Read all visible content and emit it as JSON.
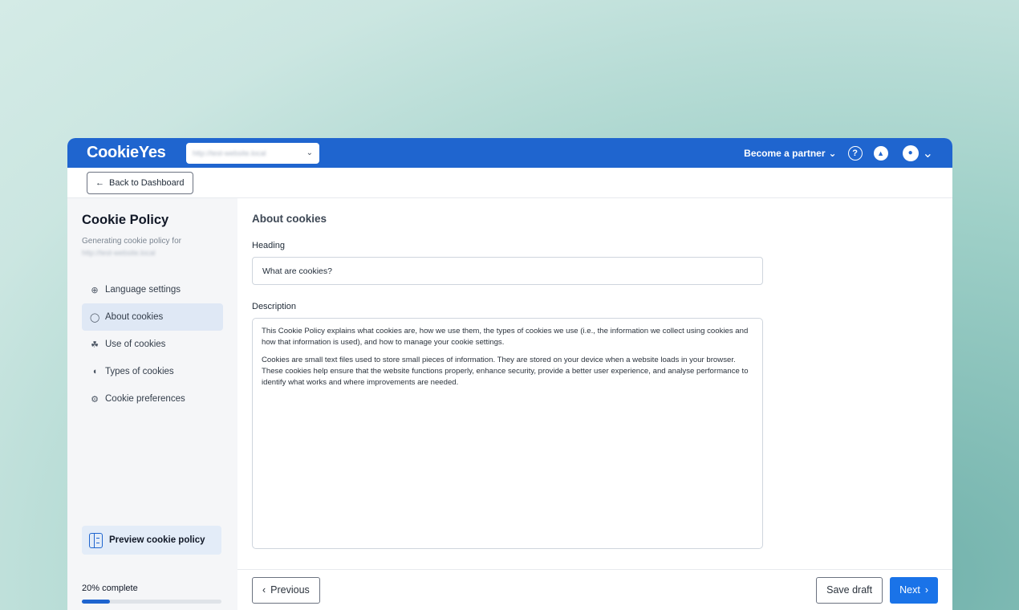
{
  "topbar": {
    "logo": "CookieYes",
    "site_url": "http://test-website.local",
    "partner_label": "Become a partner",
    "icons": [
      "help-icon",
      "bell-icon",
      "user-icon"
    ]
  },
  "subbar": {
    "back_label": "Back to Dashboard"
  },
  "sidebar": {
    "title": "Cookie Policy",
    "subtitle": "Generating cookie policy for",
    "site_url": "http://test-website.local",
    "items": [
      {
        "label": "Language settings",
        "icon": "globe-icon",
        "active": false
      },
      {
        "label": "About cookies",
        "icon": "cookie-icon",
        "active": true
      },
      {
        "label": "Use of cookies",
        "icon": "hand-cookie-icon",
        "active": false
      },
      {
        "label": "Types of cookies",
        "icon": "types-icon",
        "active": false
      },
      {
        "label": "Cookie preferences",
        "icon": "gear-icon",
        "active": false
      }
    ],
    "preview_label": "Preview cookie policy",
    "progress_label": "20% complete",
    "progress": 0.2
  },
  "main": {
    "section_title": "About cookies",
    "heading_label": "Heading",
    "heading_value": "What are cookies?",
    "description_label": "Description",
    "description_p1": "This Cookie Policy explains what cookies are, how we use them, the types of cookies we use (i.e., the information we collect using cookies and how that information is used), and how to manage your cookie settings.",
    "description_p2": "Cookies are small text files used to store small pieces of information. They are stored on your device when a website loads in your browser. These cookies help ensure that the website functions properly, enhance security, provide a better user experience, and analyse performance to identify what works and where improvements are needed."
  },
  "footer": {
    "previous_label": "Previous",
    "save_draft_label": "Save draft",
    "next_label": "Next"
  },
  "colors": {
    "brand": "#1f65cf",
    "primary_button": "#1a73e8",
    "active_nav": "#dfe8f5"
  }
}
